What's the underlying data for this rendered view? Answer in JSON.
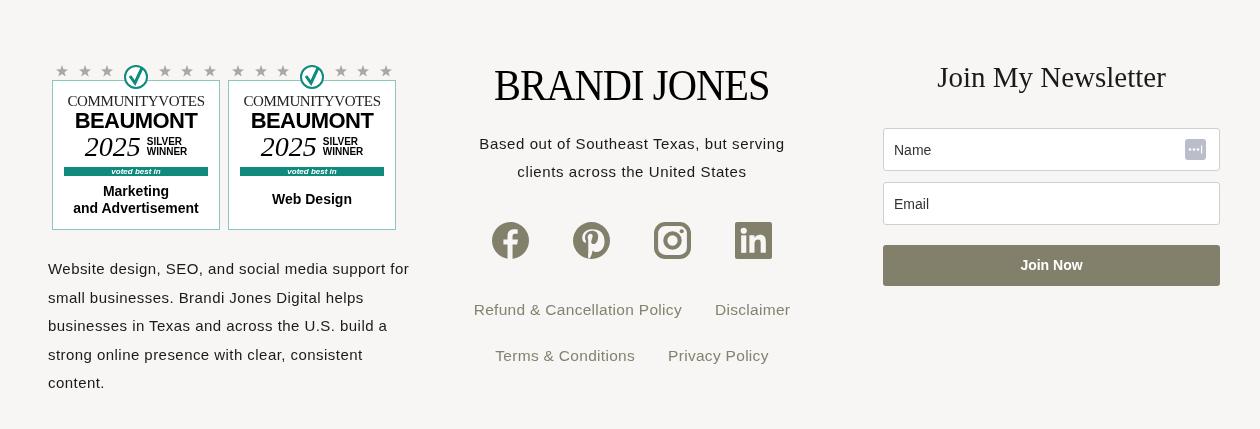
{
  "badges": [
    {
      "brand": "COMMUNITYVOTES",
      "city": "BEAUMONT",
      "year": "2025",
      "award": [
        "SILVER",
        "WINNER"
      ],
      "band": "voted best in",
      "category": [
        "Marketing",
        "and Advertisement"
      ]
    },
    {
      "brand": "COMMUNITYVOTES",
      "city": "BEAUMONT",
      "year": "2025",
      "award": [
        "SILVER",
        "WINNER"
      ],
      "band": "voted best in",
      "category": [
        "Web Design"
      ]
    }
  ],
  "about": "Website design, SEO, and social media support for small businesses. Brandi Jones Digital helps businesses in Texas and across the U.S. build a strong online presence with clear, consistent content.",
  "logo": "BRANDI JONES",
  "tagline": "Based out of Southeast Texas, but serving clients across the United States",
  "social": [
    {
      "kind": "facebook"
    },
    {
      "kind": "pinterest"
    },
    {
      "kind": "instagram"
    },
    {
      "kind": "linkedin"
    }
  ],
  "links": [
    [
      "Refund & Cancellation Policy",
      "Disclaimer"
    ],
    [
      "Terms & Conditions",
      "Privacy Policy"
    ]
  ],
  "newsletter": {
    "title": "Join My Newsletter",
    "fields": [
      {
        "placeholder": "Name",
        "autofill_icon": true
      },
      {
        "placeholder": "Email",
        "autofill_icon": false
      }
    ],
    "button": "Join Now"
  }
}
